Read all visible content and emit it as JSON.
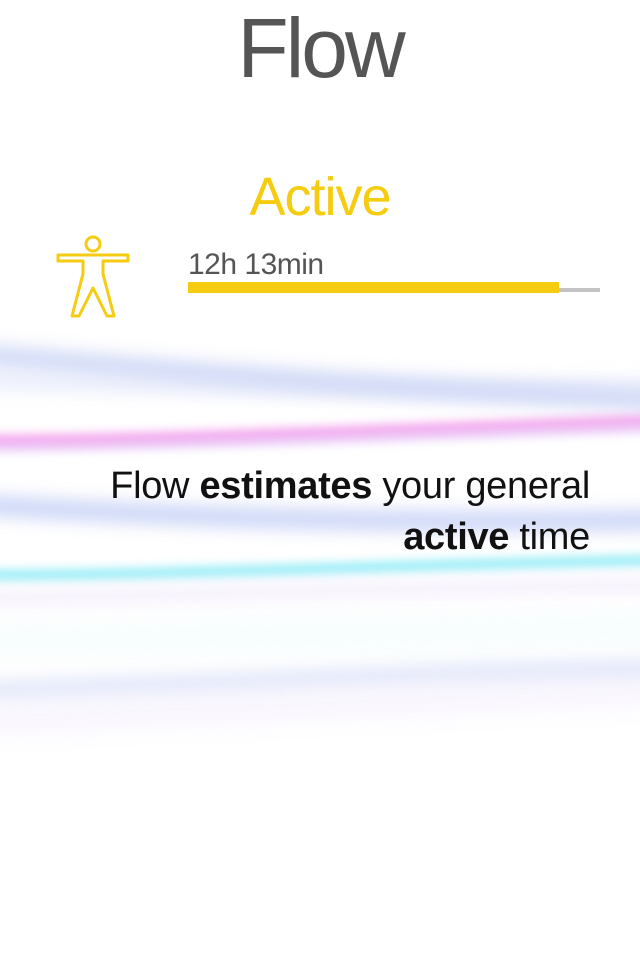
{
  "app": {
    "title": "Flow"
  },
  "activity": {
    "label": "Active",
    "duration": "12h 13min",
    "progress": 0.9,
    "accent_color": "#f5cc10",
    "track_color": "#c4c4c4",
    "icon": "person-figure-icon"
  },
  "caption": {
    "part1": "Flow ",
    "bold1": "estimates",
    "part2": " your general ",
    "bold2": "active",
    "part3": " time"
  }
}
